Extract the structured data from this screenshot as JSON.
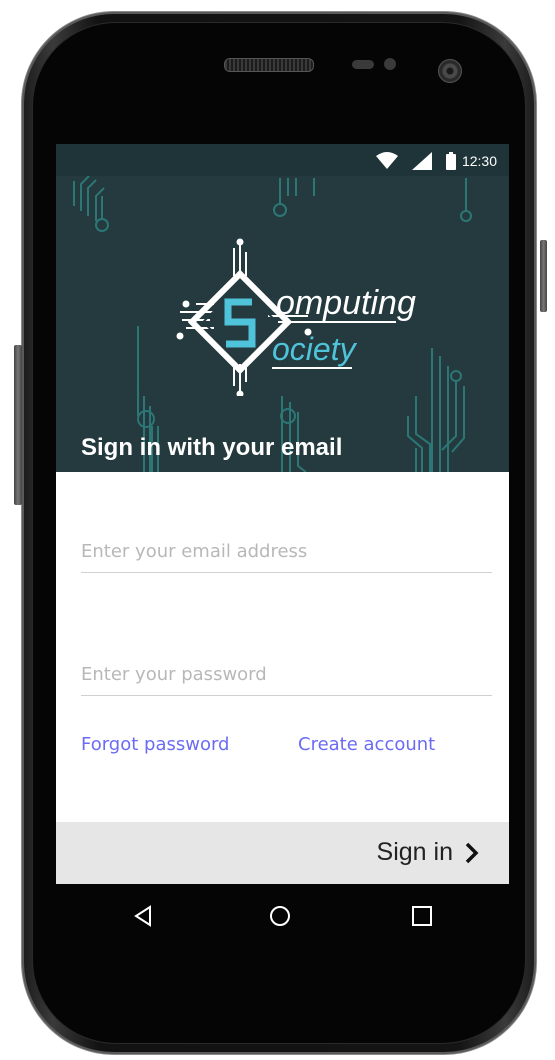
{
  "status_bar": {
    "time": "12:30",
    "wifi_icon": "wifi-icon",
    "signal_icon": "cellular-signal-icon",
    "battery_icon": "battery-icon"
  },
  "header": {
    "logo_line1": "omputing",
    "logo_line2": "ociety",
    "title": "Sign in with your email"
  },
  "form": {
    "email_placeholder": "Enter your email address",
    "email_value": "",
    "password_placeholder": "Enter your password",
    "password_value": ""
  },
  "links": {
    "forgot_password": "Forgot password",
    "create_account": "Create account"
  },
  "footer": {
    "signin_label": "Sign in",
    "signin_icon": "chevron-right-icon"
  },
  "navbar": {
    "back_icon": "back-triangle-icon",
    "home_icon": "home-circle-icon",
    "recents_icon": "recents-square-icon"
  },
  "colors": {
    "header_bg": "#243a3e",
    "link": "#6b6bf5",
    "footer_bg": "#e6e6e6",
    "logo_accent": "#4fc3d9"
  }
}
